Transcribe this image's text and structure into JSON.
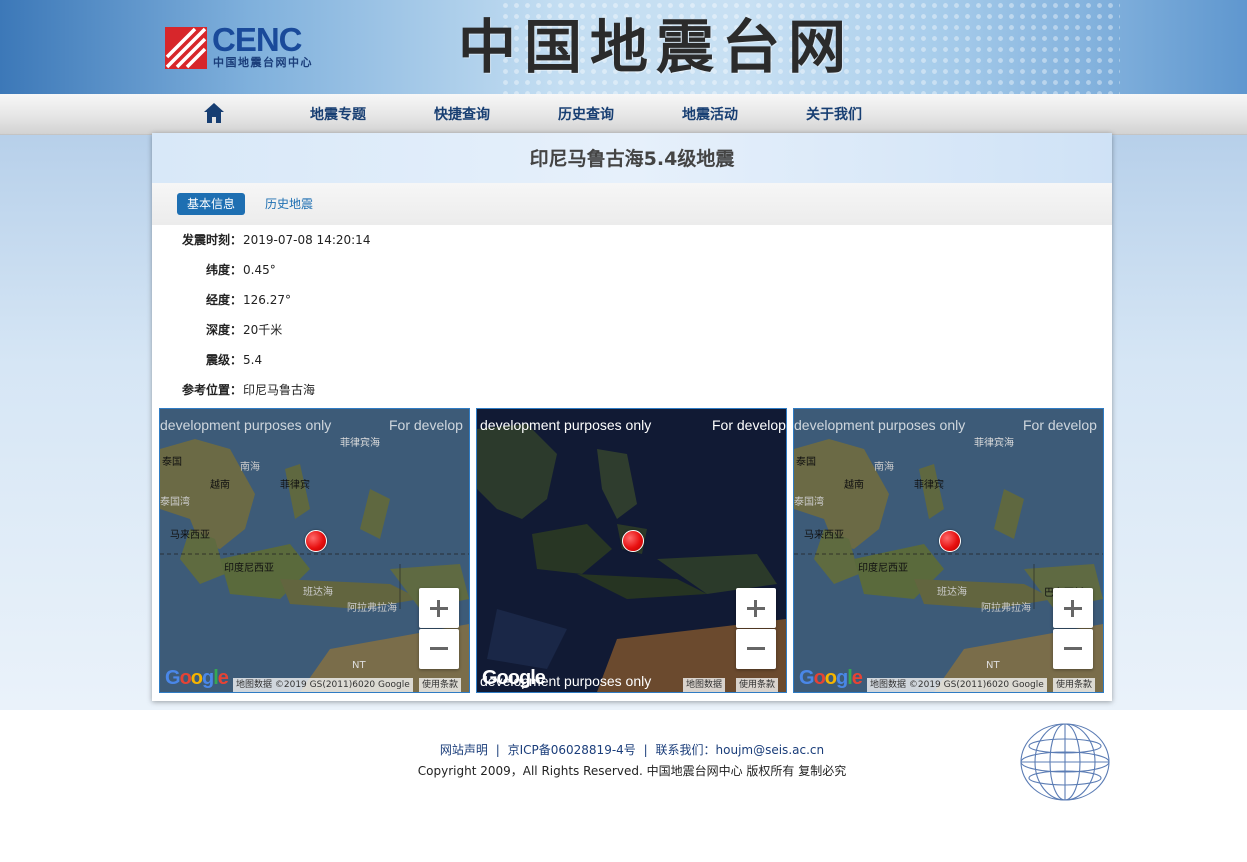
{
  "header": {
    "logo_text": "CENC",
    "logo_subtitle": "中国地震台网中心",
    "site_title": "中国地震台网"
  },
  "nav": {
    "home_icon": "home-icon",
    "items": [
      {
        "label": "地震专题"
      },
      {
        "label": "快捷查询"
      },
      {
        "label": "历史查询"
      },
      {
        "label": "地震活动"
      },
      {
        "label": "关于我们"
      }
    ]
  },
  "event": {
    "title": "印尼马鲁古海5.4级地震",
    "tabs": [
      {
        "label": "基本信息",
        "active": true
      },
      {
        "label": "历史地震",
        "active": false
      }
    ],
    "fields": [
      {
        "label": "发震时刻：",
        "value": "2019-07-08 14:20:14"
      },
      {
        "label": "纬度：",
        "value": "0.45°"
      },
      {
        "label": "经度：",
        "value": "126.27°"
      },
      {
        "label": "深度：",
        "value": "20千米"
      },
      {
        "label": "震级：",
        "value": "5.4"
      },
      {
        "label": "参考位置：",
        "value": "印尼马鲁古海"
      }
    ]
  },
  "maps": {
    "watermark_left": "development purposes only",
    "watermark_right": "For develop",
    "watermark_bottom": "development purposes only",
    "google_logo": "Google",
    "attribution": "地图数据 ©2019 GS(2011)6020 Google",
    "attribution_short": "地图数据",
    "terms": "使用条款",
    "labels": {
      "thailand": "泰国",
      "vietnam": "越南",
      "philippines": "菲律宾",
      "philippine_sea": "菲律宾海",
      "south_china_sea": "南海",
      "gulf_thailand": "泰国湾",
      "malaysia": "马来西亚",
      "indonesia": "印度尼西亚",
      "banda_sea": "班达海",
      "arafura_sea": "阿拉弗拉海",
      "png": "巴布亚新",
      "nt": "NT"
    },
    "zoom_in": "+",
    "zoom_out": "−"
  },
  "colors": {
    "nav_text": "#173e72",
    "tab_active": "#1e6fb2",
    "map_border": "#2f7cc4",
    "quake_marker": "#e81010"
  },
  "footer": {
    "link_statement": "网站声明",
    "link_icp": "京ICP备06028819-4号",
    "contact_label": "联系我们：",
    "contact_email": "houjm@seis.ac.cn",
    "separator": "|",
    "copyright": "Copyright 2009，All Rights Reserved. 中国地震台网中心 版权所有 复制必究"
  }
}
